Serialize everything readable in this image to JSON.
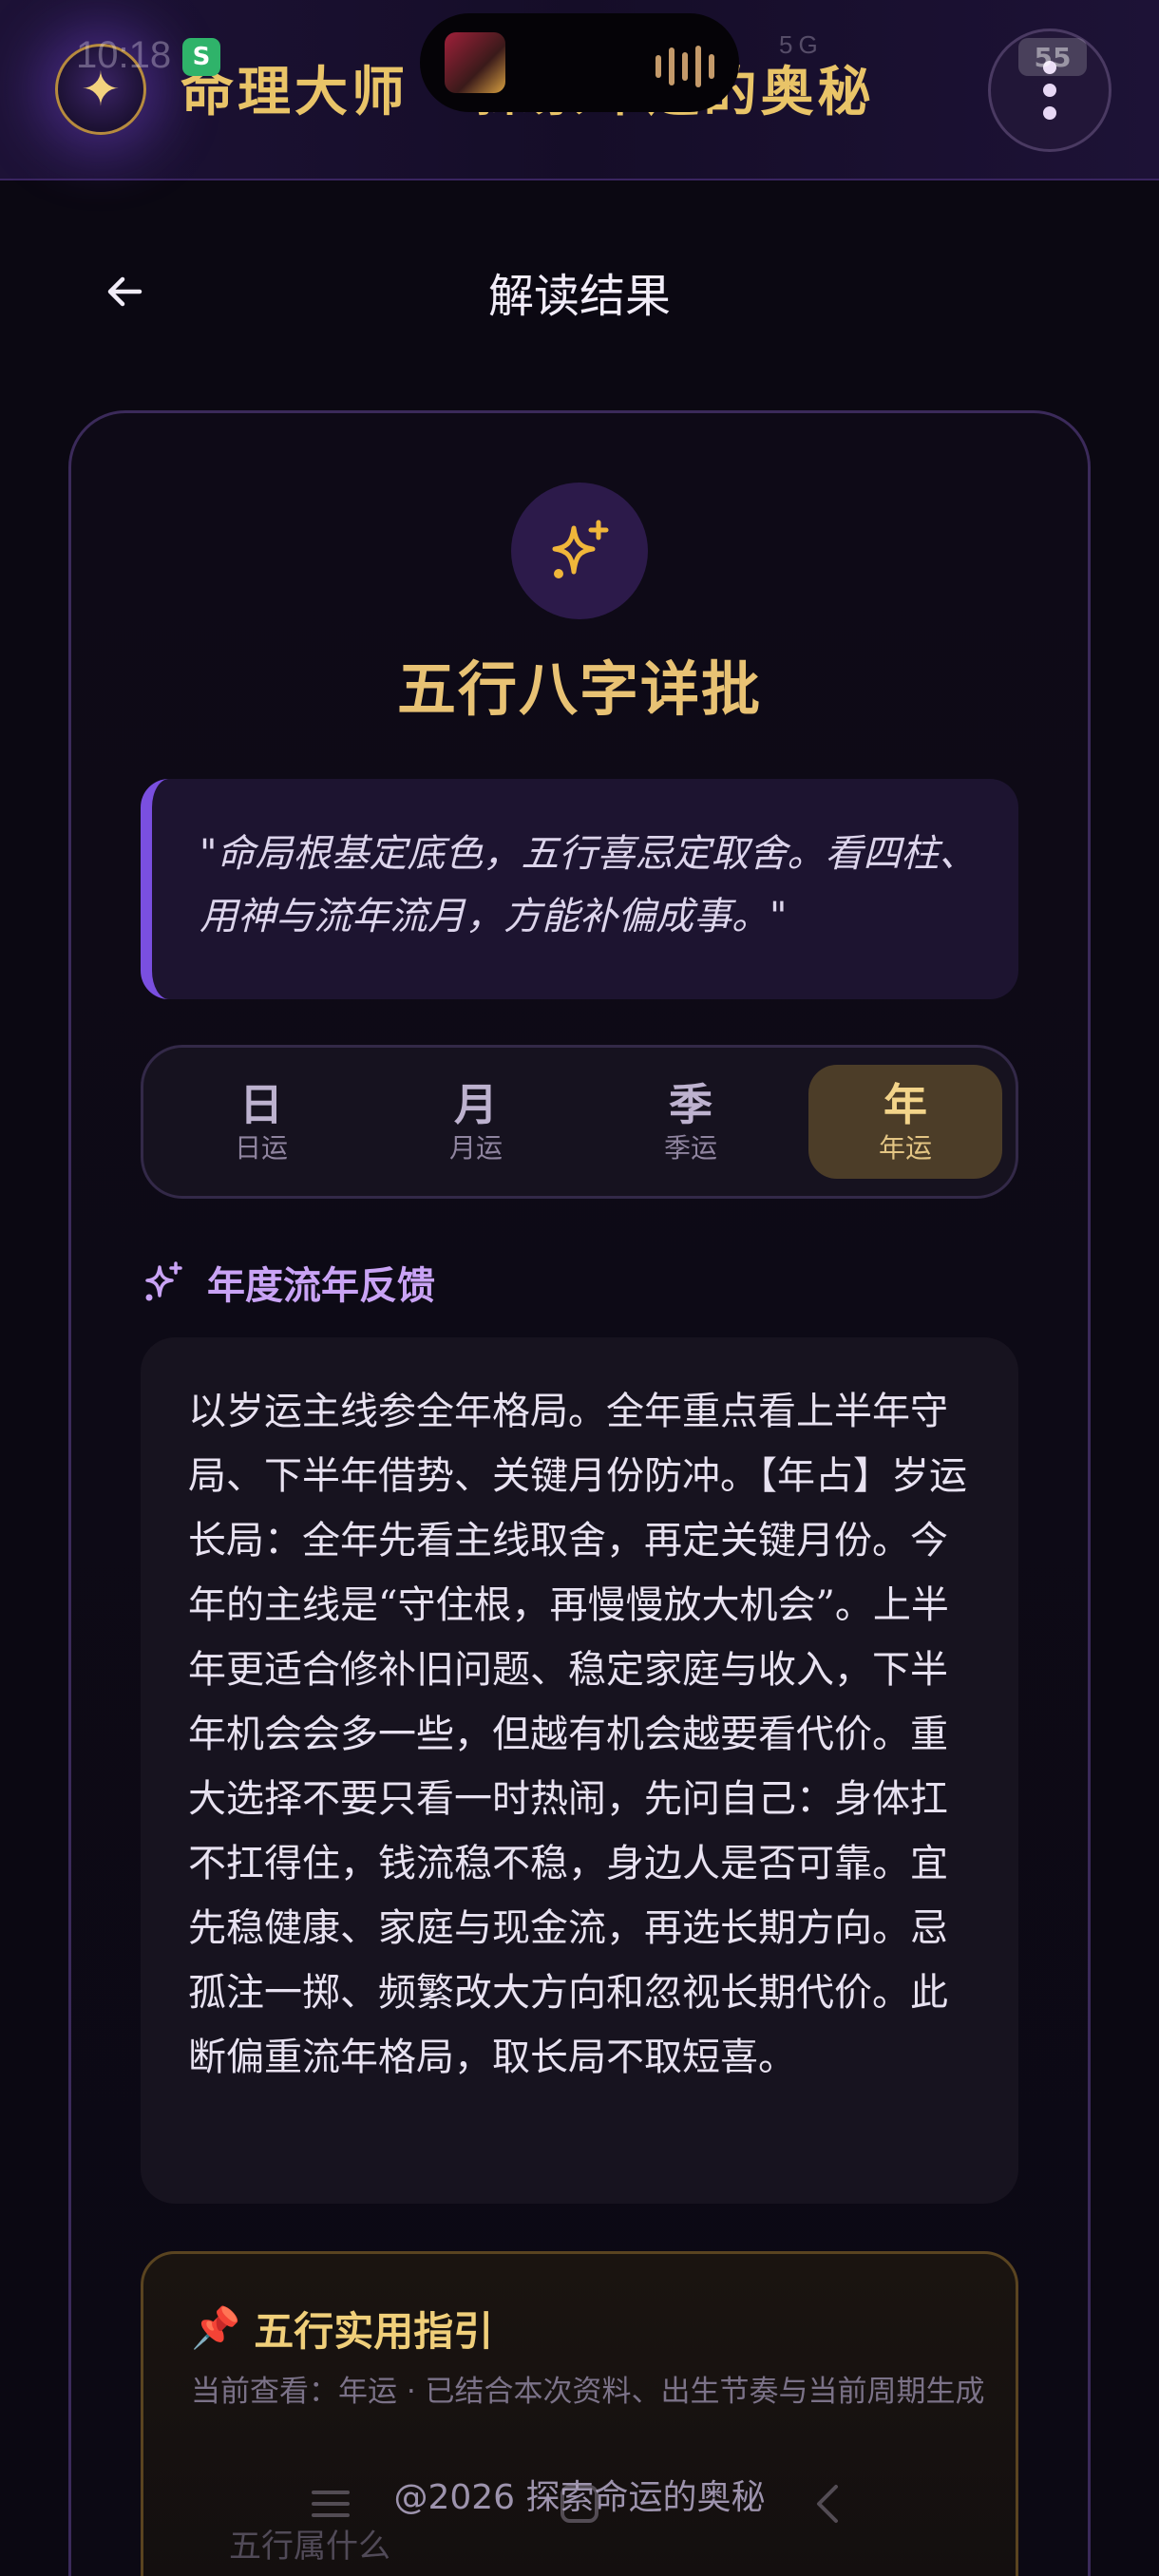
{
  "status_bar": {
    "time": "10:18",
    "signal": "5G",
    "battery": "55"
  },
  "app_bar": {
    "title": "命理大师 · 探索命运的奥秘",
    "brand_icon": "sparkle-icon",
    "menu_icon": "more-vertical-icon"
  },
  "header": {
    "title": "解读结果",
    "back_icon": "arrow-left-icon"
  },
  "card": {
    "icon": "sparkles-icon",
    "title": "五行八字详批",
    "quote": "\"命局根基定底色，五行喜忌定取舍。看四柱、用神与流年流月，方能补偏成事。\""
  },
  "tabs": [
    {
      "label": "日",
      "sub": "日运",
      "active": false
    },
    {
      "label": "月",
      "sub": "月运",
      "active": false
    },
    {
      "label": "季",
      "sub": "季运",
      "active": false
    },
    {
      "label": "年",
      "sub": "年运",
      "active": true
    }
  ],
  "feedback": {
    "heading": "年度流年反馈",
    "body": "以岁运主线参全年格局。全年重点看上半年守局、下半年借势、关键月份防冲。【年占】岁运长局：全年先看主线取舍，再定关键月份。今年的主线是“守住根，再慢慢放大机会”。上半年更适合修补旧问题、稳定家庭与收入，下半年机会会多一些，但越有机会越要看代价。重大选择不要只看一时热闹，先问自己：身体扛不扛得住，钱流稳不稳，身边人是否可靠。宜先稳健康、家庭与现金流，再选长期方向。忌孤注一掷、频繁改大方向和忽视长期代价。此断偏重流年格局，取长局不取短喜。"
  },
  "guide": {
    "emoji": "📌",
    "title": "五行实用指引",
    "subtitle": "当前查看：年运 · 已结合本次资料、出生节奏与当前周期生成",
    "next_item": "五行属什么"
  },
  "footer": {
    "text": "@2026 探索命运的奥秘"
  },
  "colors": {
    "gold": "#e8c274",
    "purple_accent": "#7a4fe0",
    "background": "#0b0812"
  }
}
